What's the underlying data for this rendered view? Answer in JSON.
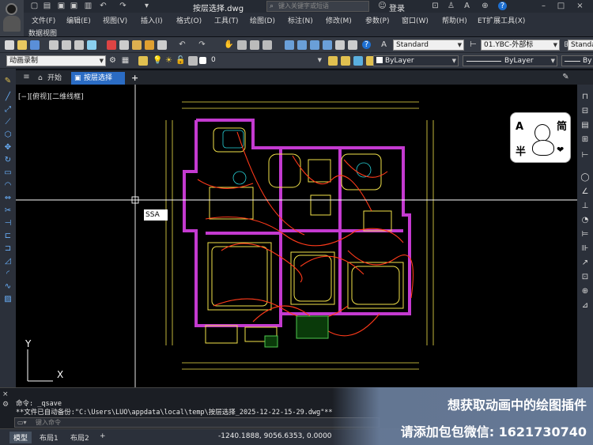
{
  "titlebar": {
    "filename": "按层选择.dwg",
    "search_placeholder": "键入关键字或短语",
    "login": "登录"
  },
  "menu": {
    "items": [
      "文件(F)",
      "编辑(E)",
      "视图(V)",
      "插入(I)",
      "格式(O)",
      "工具(T)",
      "绘图(D)",
      "标注(N)",
      "修改(M)",
      "参数(P)",
      "窗口(W)",
      "帮助(H)",
      "ET扩展工具(X)"
    ],
    "sub": "数据视图"
  },
  "toolbar1": {
    "text_style": "Standard",
    "layer": "01.YBC-外部标",
    "dim_style": "Standa"
  },
  "toolbar2": {
    "workspace": "动画录制",
    "current_layer": "0",
    "color": "ByLayer",
    "linetype": "ByLayer",
    "lineweight": "By"
  },
  "tabs": {
    "start": "开始",
    "current": "按层选择",
    "add": "+"
  },
  "viewport": {
    "label": "[−][俯视][二维线框]",
    "cursor_tooltip": "SSA",
    "ucs_y": "Y",
    "ucs_x": "X"
  },
  "command": {
    "line1": "命令:  _qsave",
    "line2": "**文件已自动备份:\"C:\\Users\\LUO\\appdata\\local\\temp\\按层选择_2025-12-22-15-29.dwg\"**",
    "input_placeholder": "键入命令"
  },
  "layouts": [
    "模型",
    "布局1",
    "布局2",
    "+"
  ],
  "status": {
    "coords": "-1240.1888, 9056.6353, 0.0000"
  },
  "overlay": {
    "line1": "想获取动画中的绘图插件",
    "line2": "请添加包包微信: 1621730740"
  },
  "sticker": {
    "c1": "A",
    "c2": "简",
    "c3": "半",
    "c4": "❤"
  },
  "colors": {
    "accent": "#2b6cc4",
    "wall": "#c43ad0",
    "wiring": "#ff3a1a",
    "furniture": "#f2e24a"
  }
}
